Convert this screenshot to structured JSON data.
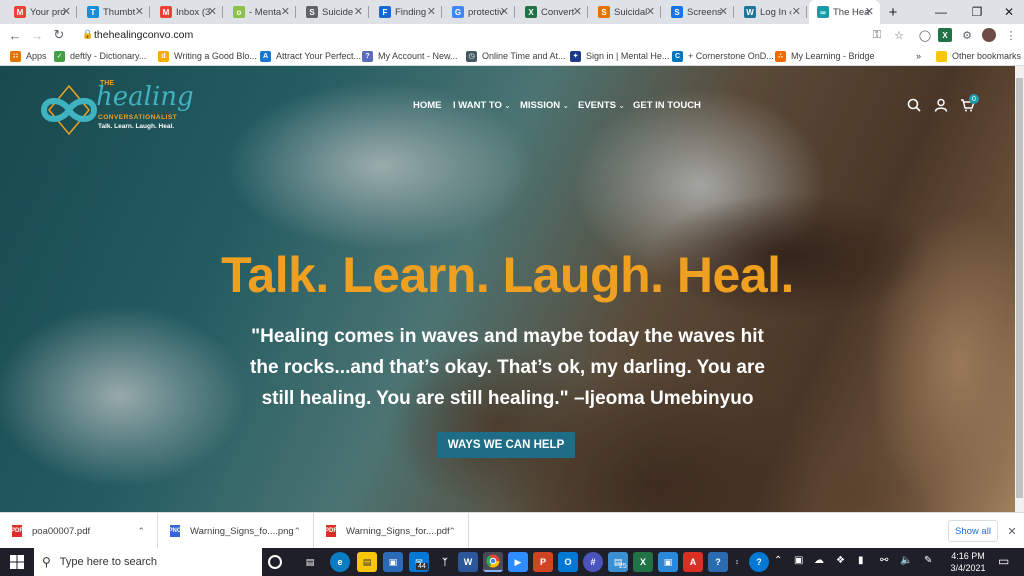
{
  "browser": {
    "tabs": [
      {
        "title": "Your pro",
        "icon": "gmail-icon",
        "color": "#ea4335",
        "glyph": "M"
      },
      {
        "title": "Thumbt",
        "icon": "thumbtack-icon",
        "color": "#1a8cd8",
        "glyph": "T"
      },
      {
        "title": "Inbox (3",
        "icon": "gmail-icon",
        "color": "#ea4335",
        "glyph": "M"
      },
      {
        "title": "- Menta",
        "icon": "circle-icon",
        "color": "#8bc34a",
        "glyph": "o"
      },
      {
        "title": "Suicide",
        "icon": "page-icon",
        "color": "#5f6368",
        "glyph": "S"
      },
      {
        "title": "Finding",
        "icon": "doc-icon",
        "color": "#1967d2",
        "glyph": "F"
      },
      {
        "title": "protectiv",
        "icon": "google-icon",
        "color": "#4285f4",
        "glyph": "G"
      },
      {
        "title": "Convert",
        "icon": "excel-icon",
        "color": "#217346",
        "glyph": "X"
      },
      {
        "title": "Suicidal",
        "icon": "folder-icon",
        "color": "#e37400",
        "glyph": "S"
      },
      {
        "title": "Screens",
        "icon": "slides-icon",
        "color": "#1a73e8",
        "glyph": "S"
      },
      {
        "title": "Log In ‹",
        "icon": "wordpress-icon",
        "color": "#21759b",
        "glyph": "W"
      },
      {
        "title": "The Hea",
        "icon": "infinity-icon",
        "color": "#1d9aa8",
        "glyph": "∞",
        "active": true
      }
    ],
    "new_tab": "+",
    "window_controls": {
      "minimize": "—",
      "maximize": "❐",
      "close": "✕"
    },
    "url": "thehealingconvo.com",
    "bookmarks": [
      {
        "label": "Apps",
        "color": "#e37400",
        "glyph": "∷"
      },
      {
        "label": "deftly - Dictionary...",
        "color": "#43a047",
        "glyph": "✓"
      },
      {
        "label": "Writing a Good Blo...",
        "color": "#f9ab00",
        "glyph": "d"
      },
      {
        "label": "Attract Your Perfect...",
        "color": "#1976d2",
        "glyph": "A"
      },
      {
        "label": "My Account - New...",
        "color": "#5c6bc0",
        "glyph": "?"
      },
      {
        "label": "Online Time and At...",
        "color": "#455a64",
        "glyph": "◷"
      },
      {
        "label": "Sign in | Mental He...",
        "color": "#1e3a8a",
        "glyph": "✦"
      },
      {
        "label": "+ Cornerstone OnD...",
        "color": "#0277bd",
        "glyph": "C"
      },
      {
        "label": "My Learning - Bridge",
        "color": "#ef6c00",
        "glyph": "∴"
      }
    ],
    "bookmarks_more": "»",
    "other_bookmarks": "Other bookmarks"
  },
  "site": {
    "logo": {
      "the": "THE",
      "healing": "healing",
      "line1": "CONVERSATIONALIST",
      "line2": "Talk. Learn. Laugh. Heal."
    },
    "nav": [
      "HOME",
      "I WANT TO",
      "MISSION",
      "EVENTS",
      "GET IN TOUCH"
    ],
    "cart_count": "0",
    "headline": "Talk. Learn. Laugh. Heal.",
    "quote": "\"Healing comes in waves and maybe today the waves hit the rocks...and that’s okay. That’s ok, my darling. You are still healing. You are still healing.\" –Ijeoma Umebinyuo",
    "cta": "WAYS WE CAN HELP",
    "colors": {
      "headline": "#f0a020",
      "cta": "#1f6c86",
      "logo_teal": "#1d9aa8",
      "logo_orange": "#f0a020"
    }
  },
  "downloads": {
    "items": [
      "poa00007.pdf",
      "Warning_Signs_fo....png",
      "Warning_Signs_for....pdf"
    ],
    "show_all": "Show all",
    "close": "✕"
  },
  "taskbar": {
    "search_placeholder": "Type here to search",
    "mail_badge": "44",
    "folder_badge": "25",
    "time": "4:16 PM",
    "date": "3/4/2021"
  }
}
